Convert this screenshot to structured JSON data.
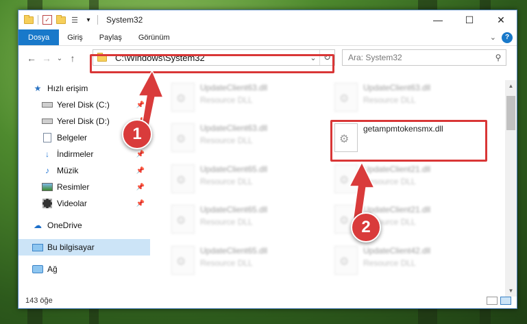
{
  "window": {
    "title": "System32",
    "controls": {
      "minimize": "—",
      "maximize": "☐",
      "close": "✕"
    }
  },
  "quick_access_toolbar": {
    "dropdown_icon": "▾"
  },
  "ribbon": {
    "tabs": [
      "Dosya",
      "Giriş",
      "Paylaş",
      "Görünüm"
    ],
    "expand_icon": "⌄",
    "help_icon": "?"
  },
  "navigation": {
    "back_icon": "←",
    "forward_icon": "→",
    "recent_icon": "⌄",
    "up_icon": "↑",
    "address_path": "C:\\Windows\\System32",
    "address_dropdown": "⌄",
    "refresh_icon": "↻",
    "search_placeholder": "Ara: System32",
    "search_icon": "⚲"
  },
  "sidebar": {
    "items": [
      {
        "label": "Hızlı erişim",
        "icon": "star-icon",
        "glyph": "★",
        "pinned": false
      },
      {
        "label": "Yerel Disk (C:)",
        "icon": "drive-icon",
        "pinned": true
      },
      {
        "label": "Yerel Disk (D:)",
        "icon": "drive-icon",
        "pinned": true
      },
      {
        "label": "Belgeler",
        "icon": "document-icon",
        "pinned": true
      },
      {
        "label": "İndirmeler",
        "icon": "download-arrow-icon",
        "glyph": "↓",
        "pinned": true
      },
      {
        "label": "Müzik",
        "icon": "music-note-icon",
        "glyph": "♪",
        "pinned": true
      },
      {
        "label": "Resimler",
        "icon": "pictures-icon",
        "pinned": true
      },
      {
        "label": "Videolar",
        "icon": "video-icon",
        "pinned": true
      },
      {
        "label": "OneDrive",
        "icon": "cloud-icon",
        "glyph": "☁",
        "pinned": false
      },
      {
        "label": "Bu bilgisayar",
        "icon": "computer-icon",
        "pinned": false,
        "selected": true
      },
      {
        "label": "Ağ",
        "icon": "network-icon",
        "pinned": false
      }
    ],
    "pin_glyph": "📌"
  },
  "files": [
    {
      "name": "UpdateClient63.dll",
      "type": "Resource DLL",
      "blurred": true
    },
    {
      "name": "UpdateClient63.dll",
      "type": "Resource DLL",
      "blurred": true
    },
    {
      "name": "UpdateClient63.dll",
      "type": "Resource DLL",
      "blurred": true
    },
    {
      "name": "getampmtokensmx.dll",
      "type": "",
      "blurred": false,
      "highlighted": true
    },
    {
      "name": "UpdateClient65.dll",
      "type": "Resource DLL",
      "blurred": true
    },
    {
      "name": "UpdateClient21.dll",
      "type": "Resource DLL",
      "blurred": true
    },
    {
      "name": "UpdateClient65.dll",
      "type": "Resource DLL",
      "blurred": true
    },
    {
      "name": "UpdateClient21.dll",
      "type": "Resource DLL",
      "blurred": true
    },
    {
      "name": "UpdateClient65.dll",
      "type": "Resource DLL",
      "blurred": true
    },
    {
      "name": "UpdateClient42.dll",
      "type": "Resource DLL",
      "blurred": true
    }
  ],
  "status": {
    "item_count": "143 öğe"
  },
  "annotations": {
    "step1": "1",
    "step2": "2",
    "color": "#d93636"
  }
}
